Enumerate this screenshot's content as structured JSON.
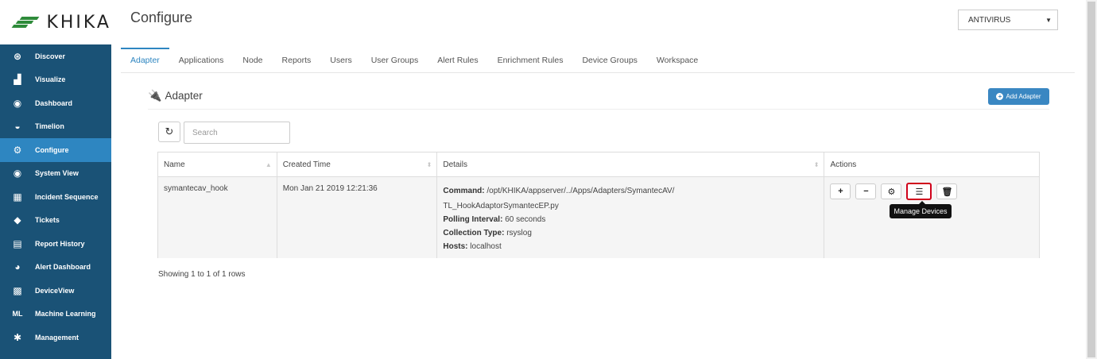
{
  "app": {
    "logo_text": "KHIKA",
    "page_title": "Configure"
  },
  "context_select": {
    "value": "ANTIVIRUS"
  },
  "sidebar": {
    "items": [
      {
        "icon": "compass-icon",
        "glyph": "⊛",
        "label": "Discover"
      },
      {
        "icon": "bar-chart-icon",
        "glyph": "▟",
        "label": "Visualize"
      },
      {
        "icon": "dashboard-icon",
        "glyph": "◉",
        "label": "Dashboard"
      },
      {
        "icon": "timelion-icon",
        "glyph": "◒",
        "label": "Timelion"
      },
      {
        "icon": "gears-icon",
        "glyph": "⚙",
        "label": "Configure"
      },
      {
        "icon": "eye-icon",
        "glyph": "◉",
        "label": "System View"
      },
      {
        "icon": "chart-icon",
        "glyph": "▦",
        "label": "Incident Sequence"
      },
      {
        "icon": "tag-icon",
        "glyph": "◆",
        "label": "Tickets"
      },
      {
        "icon": "list-icon",
        "glyph": "▤",
        "label": "Report History"
      },
      {
        "icon": "gauge-icon",
        "glyph": "◕",
        "label": "Alert Dashboard"
      },
      {
        "icon": "device-icon",
        "glyph": "▩",
        "label": "DeviceView"
      },
      {
        "icon": "ml-icon",
        "glyph": "ML",
        "label": "Machine Learning"
      },
      {
        "icon": "gear-icon",
        "glyph": "✱",
        "label": "Management"
      }
    ]
  },
  "tabs": [
    "Adapter",
    "Applications",
    "Node",
    "Reports",
    "Users",
    "User Groups",
    "Alert Rules",
    "Enrichment Rules",
    "Device Groups",
    "Workspace"
  ],
  "section": {
    "title": "Adapter",
    "add_button": "Add Adapter"
  },
  "search": {
    "placeholder": "Search"
  },
  "table": {
    "headers": [
      "Name",
      "Created Time",
      "Details",
      "Actions"
    ],
    "rows": [
      {
        "name": "symantecav_hook",
        "created": "Mon Jan 21 2019 12:21:36",
        "command_label": "Command:",
        "command_value": "/opt/KHIKA/appserver/../Apps/Adapters/SymantecAV/",
        "command_cont": "TL_HookAdaptorSymantecEP.py",
        "polling_label": "Polling Interval:",
        "polling_value": "60 seconds",
        "collection_label": "Collection Type:",
        "collection_value": "rsyslog",
        "hosts_label": "Hosts:",
        "hosts_value": "localhost"
      }
    ]
  },
  "actions_tooltip": "Manage Devices",
  "pagination": {
    "showing": "Showing 1 to 1 of 1 rows"
  },
  "colors": {
    "sidebar_bg": "#1a5276",
    "sidebar_active": "#2e86c1",
    "accent": "#2e86c1",
    "highlight": "#d0021b"
  }
}
